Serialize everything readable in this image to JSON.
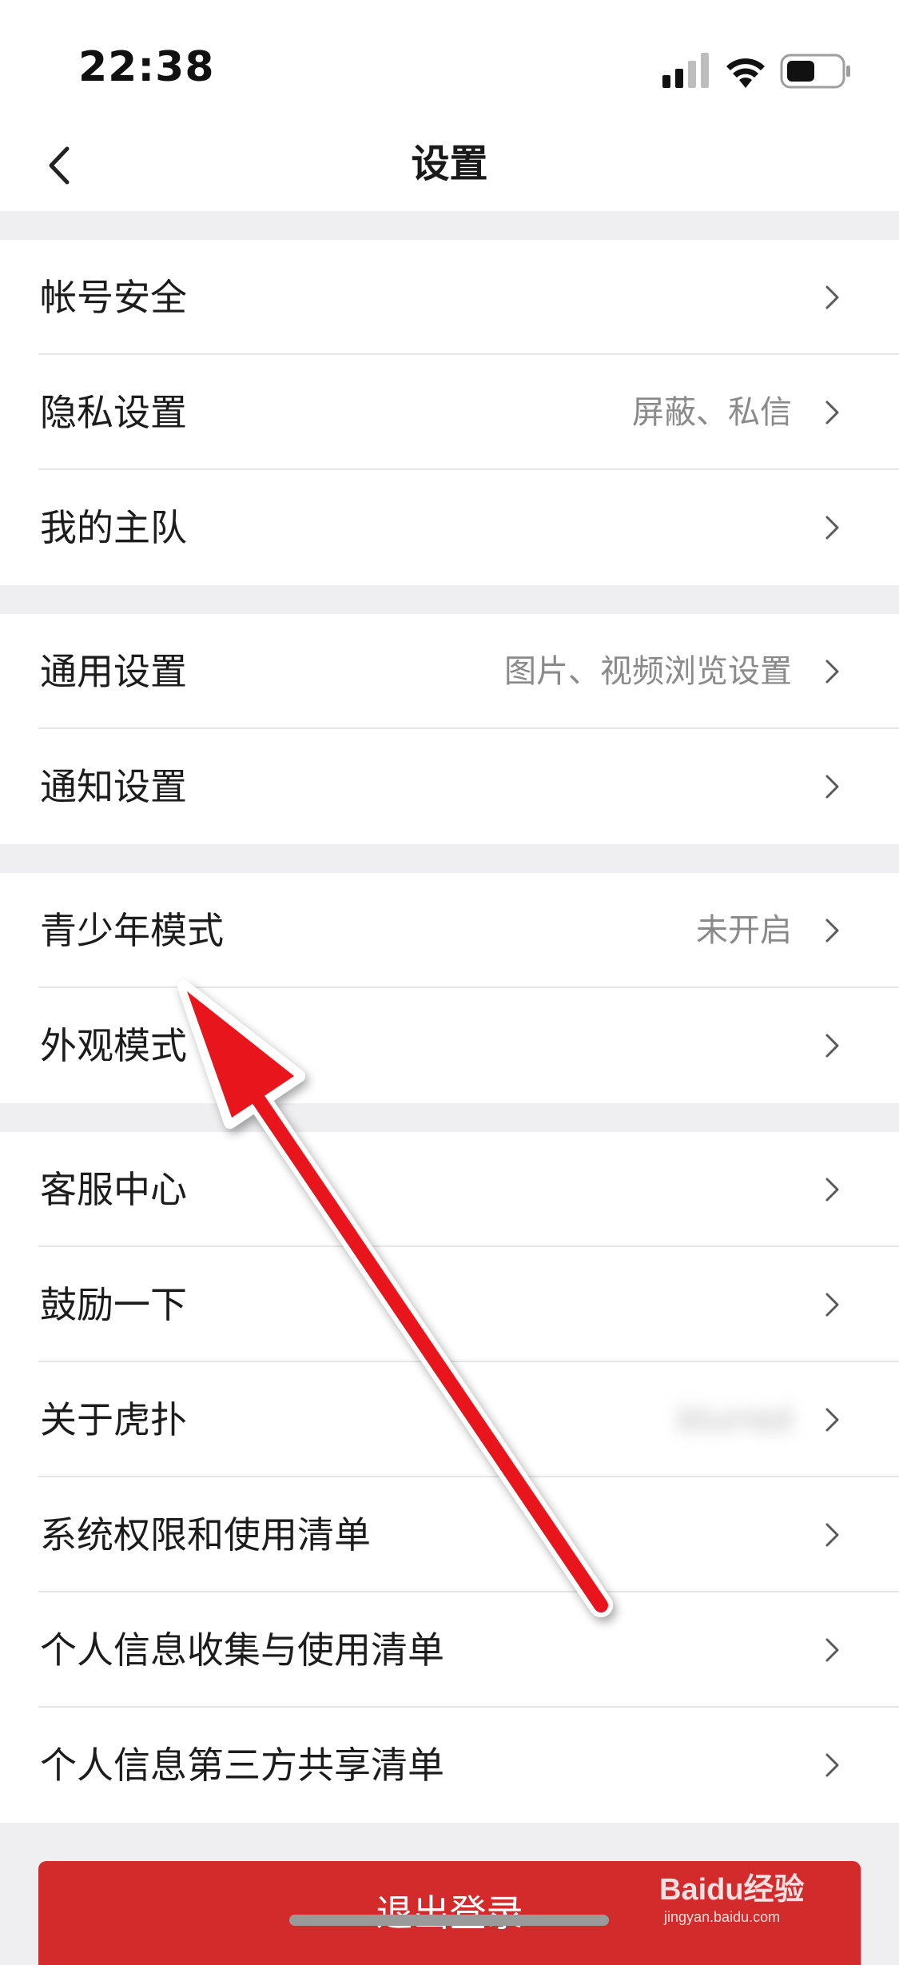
{
  "status_bar": {
    "time": "22:38",
    "icons": [
      "signal-icon",
      "wifi-icon",
      "battery-icon"
    ]
  },
  "header": {
    "title": "设置",
    "back_icon": "chevron-left-icon"
  },
  "groups": [
    {
      "items": [
        {
          "label": "帐号安全",
          "value": ""
        },
        {
          "label": "隐私设置",
          "value": "屏蔽、私信"
        },
        {
          "label": "我的主队",
          "value": ""
        }
      ]
    },
    {
      "items": [
        {
          "label": "通用设置",
          "value": "图片、视频浏览设置"
        },
        {
          "label": "通知设置",
          "value": ""
        }
      ]
    },
    {
      "items": [
        {
          "label": "青少年模式",
          "value": "未开启"
        },
        {
          "label": "外观模式",
          "value": ""
        }
      ]
    },
    {
      "items": [
        {
          "label": "客服中心",
          "value": ""
        },
        {
          "label": "鼓励一下",
          "value": ""
        },
        {
          "label": "关于虎扑",
          "value": "blurred"
        },
        {
          "label": "系统权限和使用清单",
          "value": ""
        },
        {
          "label": "个人信息收集与使用清单",
          "value": ""
        },
        {
          "label": "个人信息第三方共享清单",
          "value": ""
        }
      ]
    }
  ],
  "logout": {
    "label": "退出登录"
  },
  "annotation": {
    "arrow_color": "#e8141b",
    "icon": "red-arrow-annotation"
  },
  "watermark": {
    "text": "Baidu经验",
    "subtext": "jingyan.baidu.com"
  },
  "colors": {
    "background": "#efeff1",
    "accent_red": "#d32b2b",
    "secondary_text": "#8a8a8a"
  }
}
